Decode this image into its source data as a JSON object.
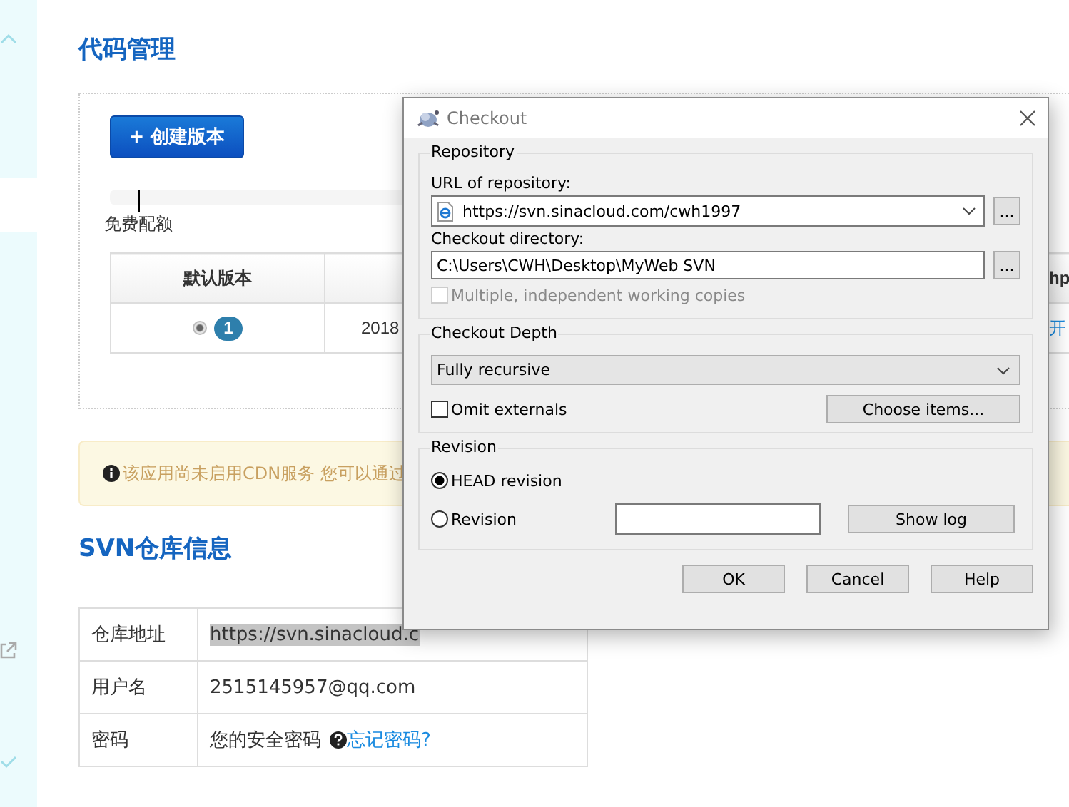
{
  "page": {
    "title": "代码管理",
    "create_button": "+ 创建版本",
    "quota_label": "免费配额",
    "versions_table": {
      "column_1": "默认版本",
      "column_3": "hp",
      "rows": [
        {
          "selected": true,
          "version": "1",
          "column_2": "2018",
          "column_3": "开"
        }
      ]
    },
    "notice": "该应用尚未启用CDN服务 您可以通过",
    "svn_title": "SVN仓库信息",
    "svn_table": [
      {
        "label": "仓库地址",
        "value": "https://svn.sinacloud.c",
        "kind": "highlighted"
      },
      {
        "label": "用户名",
        "value": "2515145957@qq.com",
        "kind": "plain"
      },
      {
        "label": "密码",
        "value": "您的安全密码",
        "kind": "help",
        "link": "忘记密码?"
      }
    ]
  },
  "dialog": {
    "title": "Checkout",
    "repository": {
      "label": "Repository",
      "url_label": "URL of repository:",
      "url": "https://svn.sinacloud.com/cwh1997",
      "url_browse": "...",
      "directory_label": "Checkout directory:",
      "directory": "C:\\Users\\CWH\\Desktop\\MyWeb SVN",
      "directory_browse": "...",
      "multiple": {
        "label": "Multiple, independent working copies",
        "checked": false,
        "disabled": true
      }
    },
    "depth": {
      "label": "Checkout Depth",
      "value": "Fully recursive",
      "omit_externals": {
        "label": "Omit externals",
        "checked": false,
        "disabled": false
      },
      "choose_button": "Choose items..."
    },
    "revision": {
      "label": "Revision",
      "options": [
        {
          "label": "HEAD revision",
          "selected": true
        },
        {
          "label": "Revision",
          "selected": false
        }
      ],
      "show_log": "Show log"
    },
    "buttons": [
      "OK",
      "Cancel",
      "Help"
    ]
  }
}
